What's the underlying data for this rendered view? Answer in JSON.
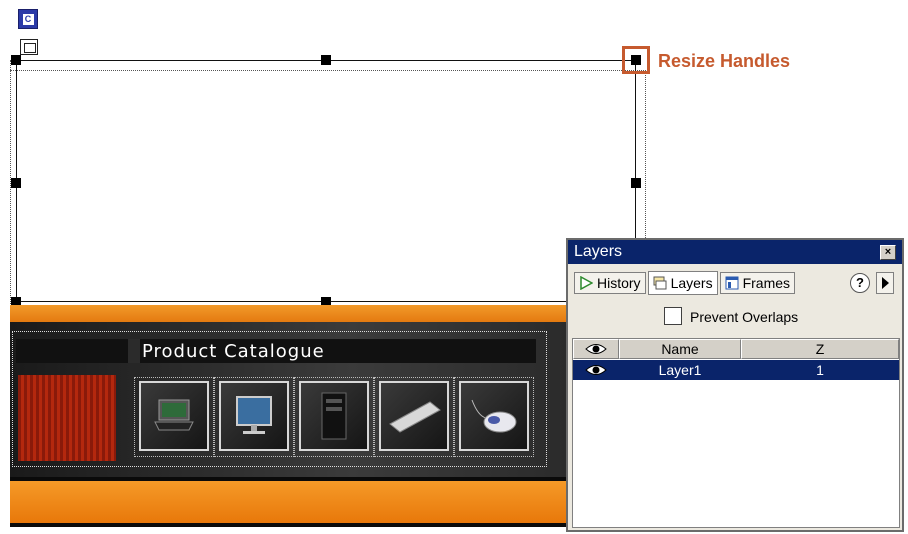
{
  "callout": {
    "label": "Resize Handles",
    "color": "#c65a2e"
  },
  "banner": {
    "title": "Product Catalogue"
  },
  "panel": {
    "title": "Layers",
    "close_glyph": "×",
    "tabs": [
      {
        "label": "History",
        "icon": "history-icon"
      },
      {
        "label": "Layers",
        "icon": "layers-icon"
      },
      {
        "label": "Frames",
        "icon": "frames-icon"
      }
    ],
    "active_tab": "Layers",
    "help_glyph": "?",
    "prevent_overlaps": {
      "label": "Prevent Overlaps",
      "checked": false
    },
    "columns": {
      "visibility": "eye-icon",
      "name": "Name",
      "z": "Z"
    },
    "rows": [
      {
        "visible": true,
        "name": "Layer1",
        "z": "1",
        "selected": true
      }
    ]
  },
  "colors": {
    "titlebar": "#0a246a",
    "banner_orange": "#f29a2a"
  }
}
